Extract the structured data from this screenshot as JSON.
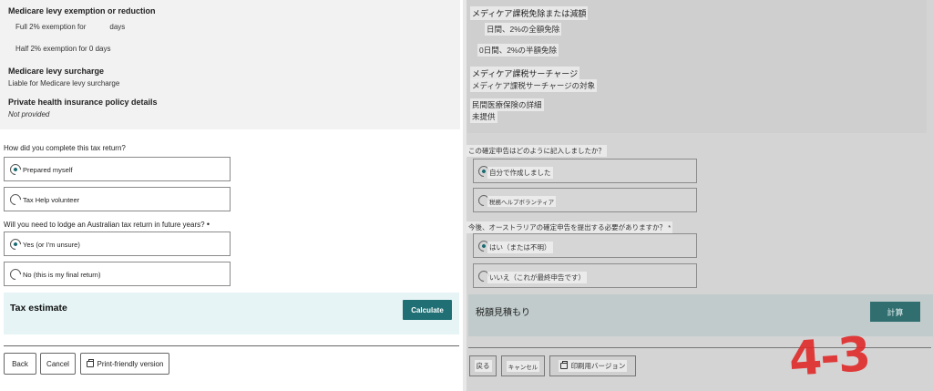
{
  "left": {
    "summary": {
      "exemption_heading": "Medicare levy exemption or reduction",
      "full_exemption_prefix": "Full 2% exemption for",
      "full_exemption_suffix": "days",
      "half_exemption": "Half 2% exemption for 0 days",
      "surcharge_heading": "Medicare levy surcharge",
      "surcharge_value": "Liable for Medicare levy surcharge",
      "phi_heading": "Private health insurance policy details",
      "phi_value": "Not provided"
    },
    "question1": {
      "label": "How did you complete this tax return?",
      "options": [
        "Prepared myself",
        "Tax Help volunteer"
      ],
      "selected": 0
    },
    "question2": {
      "label": "Will you need to lodge an Australian tax return in future years?",
      "required_mark": "•",
      "options": [
        "Yes (or I'm unsure)",
        "No (this is my final return)"
      ],
      "selected": 0
    },
    "estimate": {
      "title": "Tax estimate",
      "calculate": "Calculate"
    },
    "buttons": {
      "back": "Back",
      "cancel": "Cancel",
      "print": "Print-friendly version"
    }
  },
  "right": {
    "summary": {
      "exemption_heading": "メディケア課税免除または減額",
      "full_exemption": "日間、2%の全額免除",
      "half_exemption": "0日間、2%の半額免除",
      "surcharge_heading": "メディケア課税サーチャージ",
      "surcharge_value": "メディケア課税サーチャージの対象",
      "phi_heading": "民間医療保険の詳細",
      "phi_value": "未提供"
    },
    "question1": {
      "label": "この確定申告はどのように記入しましたか？",
      "options": [
        "自分で作成しました",
        "税務ヘルプボランティア"
      ],
      "selected": 0
    },
    "question2": {
      "label": "今後、オーストラリアの確定申告を提出する必要がありますか？ *",
      "options": [
        "はい（または不明）",
        "いいえ（これが最終申告です）"
      ],
      "selected": 0
    },
    "estimate": {
      "title": "税額見積もり",
      "calculate": "計算"
    },
    "buttons": {
      "back": "戻る",
      "cancel": "キャンセル",
      "print": "印刷用バージョン"
    },
    "stamp": "4-3"
  },
  "colors": {
    "accent": "#1f6f74",
    "estimate_bg": "#e6f4f5",
    "summary_bg": "#f2f2f2",
    "stamp": "#e02a2a"
  }
}
